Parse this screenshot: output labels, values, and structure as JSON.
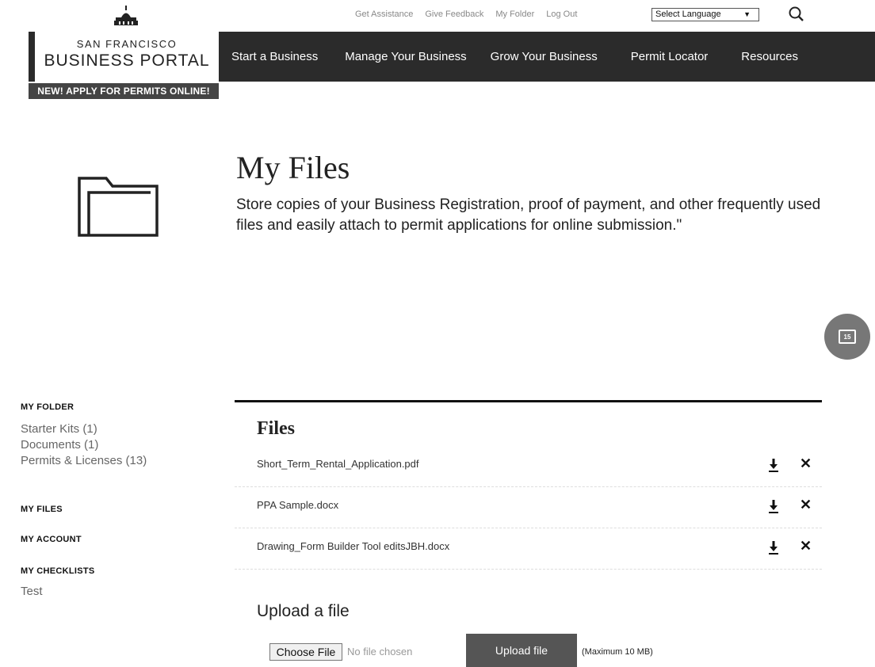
{
  "util": {
    "links": [
      "Get Assistance",
      "Give Feedback",
      "My Folder",
      "Log Out"
    ],
    "language": "Select Language"
  },
  "brand": {
    "top": "SAN FRANCISCO",
    "main": "BUSINESS PORTAL",
    "banner": "NEW! APPLY FOR PERMITS ONLINE!"
  },
  "nav": {
    "items": [
      "Start a Business",
      "Manage Your Business",
      "Grow Your Business",
      "Permit Locator",
      "Resources"
    ]
  },
  "hero": {
    "title": "My Files",
    "text": "Store copies of your Business Registration, proof of payment, and other frequently used files and easily attach to permit applications for online submission.\""
  },
  "badge": {
    "count": "15"
  },
  "sidebar": {
    "my_folder": "MY FOLDER",
    "folder_items": [
      "Starter Kits (1)",
      "Documents (1)",
      "Permits & Licenses (13)"
    ],
    "my_files": "MY FILES",
    "my_account": "MY ACCOUNT",
    "my_checklists": "MY CHECKLISTS",
    "checklist_items": [
      "Test"
    ]
  },
  "files": {
    "title": "Files",
    "items": [
      {
        "name": "Short_Term_Rental_Application.pdf"
      },
      {
        "name": "PPA Sample.docx"
      },
      {
        "name": "Drawing_Form Builder Tool editsJBH.docx"
      }
    ]
  },
  "upload": {
    "title": "Upload a file",
    "choose": "Choose File",
    "no_file": "No file chosen",
    "button": "Upload file",
    "max": "(Maximum 10 MB)"
  }
}
